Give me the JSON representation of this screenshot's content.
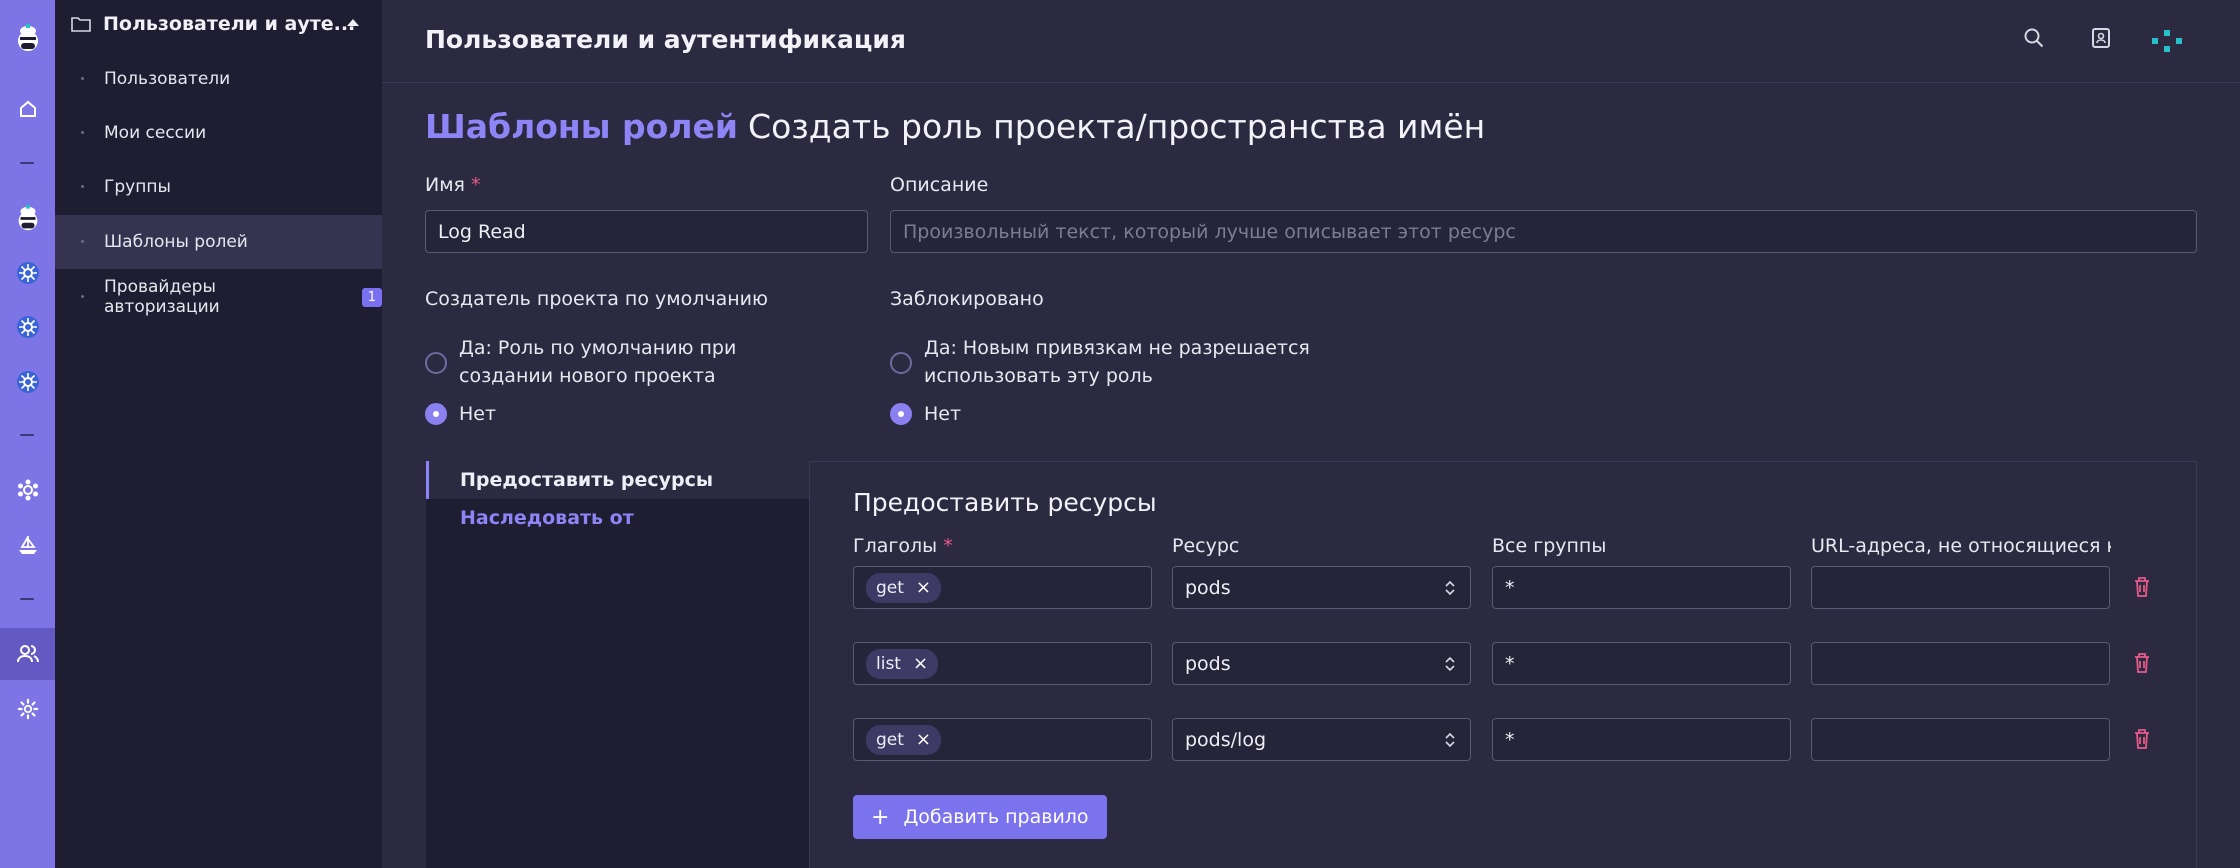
{
  "sidenav": {
    "header": "Пользователи и ауте...",
    "items": [
      {
        "label": "Пользователи"
      },
      {
        "label": "Мои сессии"
      },
      {
        "label": "Группы"
      },
      {
        "label": "Шаблоны ролей",
        "active": true
      },
      {
        "label": "Провайдеры авторизации",
        "badge": "1"
      }
    ]
  },
  "topbar": {
    "title": "Пользователи и аутентификация"
  },
  "page": {
    "breadcrumb": "Шаблоны ролей",
    "title": "Создать роль проекта/пространства имён"
  },
  "form": {
    "name_label": "Имя",
    "required_mark": "*",
    "name_value": "Log Read",
    "description_label": "Описание",
    "description_placeholder": "Произвольный текст, который лучше описывает этот ресурс",
    "default_creator_label": "Создатель проекта по умолчанию",
    "default_yes": "Да: Роль по умолчанию при создании нового проекта",
    "default_no": "Нет",
    "default_selected": "no",
    "locked_label": "Заблокировано",
    "locked_yes": "Да: Новым привязкам не разрешается использовать эту роль",
    "locked_no": "Нет",
    "locked_selected": "no"
  },
  "tabs": [
    {
      "label": "Предоставить ресурсы",
      "active": true
    },
    {
      "label": "Наследовать от",
      "active": false
    }
  ],
  "rules": {
    "title": "Предоставить ресурсы",
    "columns": {
      "verbs": "Глаголы",
      "resource": "Ресурс",
      "api_groups": "Все группы",
      "non_resource_urls": "URL-адреса, не относящиеся к..."
    },
    "rows": [
      {
        "verb": "get",
        "resource": "pods",
        "api_group": "*",
        "url": ""
      },
      {
        "verb": "list",
        "resource": "pods",
        "api_group": "*",
        "url": ""
      },
      {
        "verb": "get",
        "resource": "pods/log",
        "api_group": "*",
        "url": ""
      }
    ],
    "add_button": "Добавить правило"
  },
  "colors": {
    "accent": "#8d85f5",
    "rail": "#7d75e5",
    "danger": "#e85a8a",
    "teal": "#27c0c8"
  }
}
